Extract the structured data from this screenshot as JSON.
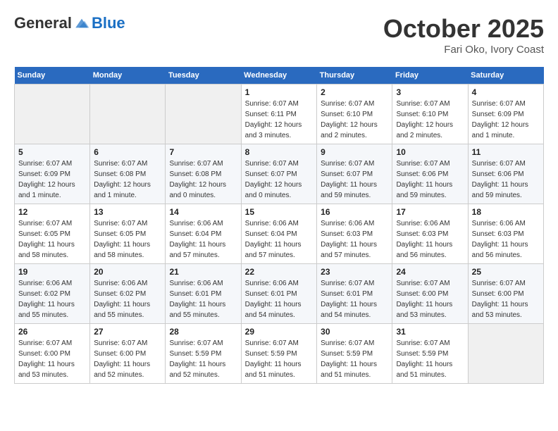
{
  "header": {
    "logo_general": "General",
    "logo_blue": "Blue",
    "month_title": "October 2025",
    "location": "Fari Oko, Ivory Coast"
  },
  "weekdays": [
    "Sunday",
    "Monday",
    "Tuesday",
    "Wednesday",
    "Thursday",
    "Friday",
    "Saturday"
  ],
  "weeks": [
    [
      null,
      null,
      null,
      {
        "day": "1",
        "sunrise": "6:07 AM",
        "sunset": "6:11 PM",
        "daylight": "12 hours and 3 minutes."
      },
      {
        "day": "2",
        "sunrise": "6:07 AM",
        "sunset": "6:10 PM",
        "daylight": "12 hours and 2 minutes."
      },
      {
        "day": "3",
        "sunrise": "6:07 AM",
        "sunset": "6:10 PM",
        "daylight": "12 hours and 2 minutes."
      },
      {
        "day": "4",
        "sunrise": "6:07 AM",
        "sunset": "6:09 PM",
        "daylight": "12 hours and 1 minute."
      }
    ],
    [
      {
        "day": "5",
        "sunrise": "6:07 AM",
        "sunset": "6:09 PM",
        "daylight": "12 hours and 1 minute."
      },
      {
        "day": "6",
        "sunrise": "6:07 AM",
        "sunset": "6:08 PM",
        "daylight": "12 hours and 1 minute."
      },
      {
        "day": "7",
        "sunrise": "6:07 AM",
        "sunset": "6:08 PM",
        "daylight": "12 hours and 0 minutes."
      },
      {
        "day": "8",
        "sunrise": "6:07 AM",
        "sunset": "6:07 PM",
        "daylight": "12 hours and 0 minutes."
      },
      {
        "day": "9",
        "sunrise": "6:07 AM",
        "sunset": "6:07 PM",
        "daylight": "11 hours and 59 minutes."
      },
      {
        "day": "10",
        "sunrise": "6:07 AM",
        "sunset": "6:06 PM",
        "daylight": "11 hours and 59 minutes."
      },
      {
        "day": "11",
        "sunrise": "6:07 AM",
        "sunset": "6:06 PM",
        "daylight": "11 hours and 59 minutes."
      }
    ],
    [
      {
        "day": "12",
        "sunrise": "6:07 AM",
        "sunset": "6:05 PM",
        "daylight": "11 hours and 58 minutes."
      },
      {
        "day": "13",
        "sunrise": "6:07 AM",
        "sunset": "6:05 PM",
        "daylight": "11 hours and 58 minutes."
      },
      {
        "day": "14",
        "sunrise": "6:06 AM",
        "sunset": "6:04 PM",
        "daylight": "11 hours and 57 minutes."
      },
      {
        "day": "15",
        "sunrise": "6:06 AM",
        "sunset": "6:04 PM",
        "daylight": "11 hours and 57 minutes."
      },
      {
        "day": "16",
        "sunrise": "6:06 AM",
        "sunset": "6:03 PM",
        "daylight": "11 hours and 57 minutes."
      },
      {
        "day": "17",
        "sunrise": "6:06 AM",
        "sunset": "6:03 PM",
        "daylight": "11 hours and 56 minutes."
      },
      {
        "day": "18",
        "sunrise": "6:06 AM",
        "sunset": "6:03 PM",
        "daylight": "11 hours and 56 minutes."
      }
    ],
    [
      {
        "day": "19",
        "sunrise": "6:06 AM",
        "sunset": "6:02 PM",
        "daylight": "11 hours and 55 minutes."
      },
      {
        "day": "20",
        "sunrise": "6:06 AM",
        "sunset": "6:02 PM",
        "daylight": "11 hours and 55 minutes."
      },
      {
        "day": "21",
        "sunrise": "6:06 AM",
        "sunset": "6:01 PM",
        "daylight": "11 hours and 55 minutes."
      },
      {
        "day": "22",
        "sunrise": "6:06 AM",
        "sunset": "6:01 PM",
        "daylight": "11 hours and 54 minutes."
      },
      {
        "day": "23",
        "sunrise": "6:07 AM",
        "sunset": "6:01 PM",
        "daylight": "11 hours and 54 minutes."
      },
      {
        "day": "24",
        "sunrise": "6:07 AM",
        "sunset": "6:00 PM",
        "daylight": "11 hours and 53 minutes."
      },
      {
        "day": "25",
        "sunrise": "6:07 AM",
        "sunset": "6:00 PM",
        "daylight": "11 hours and 53 minutes."
      }
    ],
    [
      {
        "day": "26",
        "sunrise": "6:07 AM",
        "sunset": "6:00 PM",
        "daylight": "11 hours and 53 minutes."
      },
      {
        "day": "27",
        "sunrise": "6:07 AM",
        "sunset": "6:00 PM",
        "daylight": "11 hours and 52 minutes."
      },
      {
        "day": "28",
        "sunrise": "6:07 AM",
        "sunset": "5:59 PM",
        "daylight": "11 hours and 52 minutes."
      },
      {
        "day": "29",
        "sunrise": "6:07 AM",
        "sunset": "5:59 PM",
        "daylight": "11 hours and 51 minutes."
      },
      {
        "day": "30",
        "sunrise": "6:07 AM",
        "sunset": "5:59 PM",
        "daylight": "11 hours and 51 minutes."
      },
      {
        "day": "31",
        "sunrise": "6:07 AM",
        "sunset": "5:59 PM",
        "daylight": "11 hours and 51 minutes."
      },
      null
    ]
  ],
  "labels": {
    "sunrise": "Sunrise:",
    "sunset": "Sunset:",
    "daylight": "Daylight hours"
  }
}
